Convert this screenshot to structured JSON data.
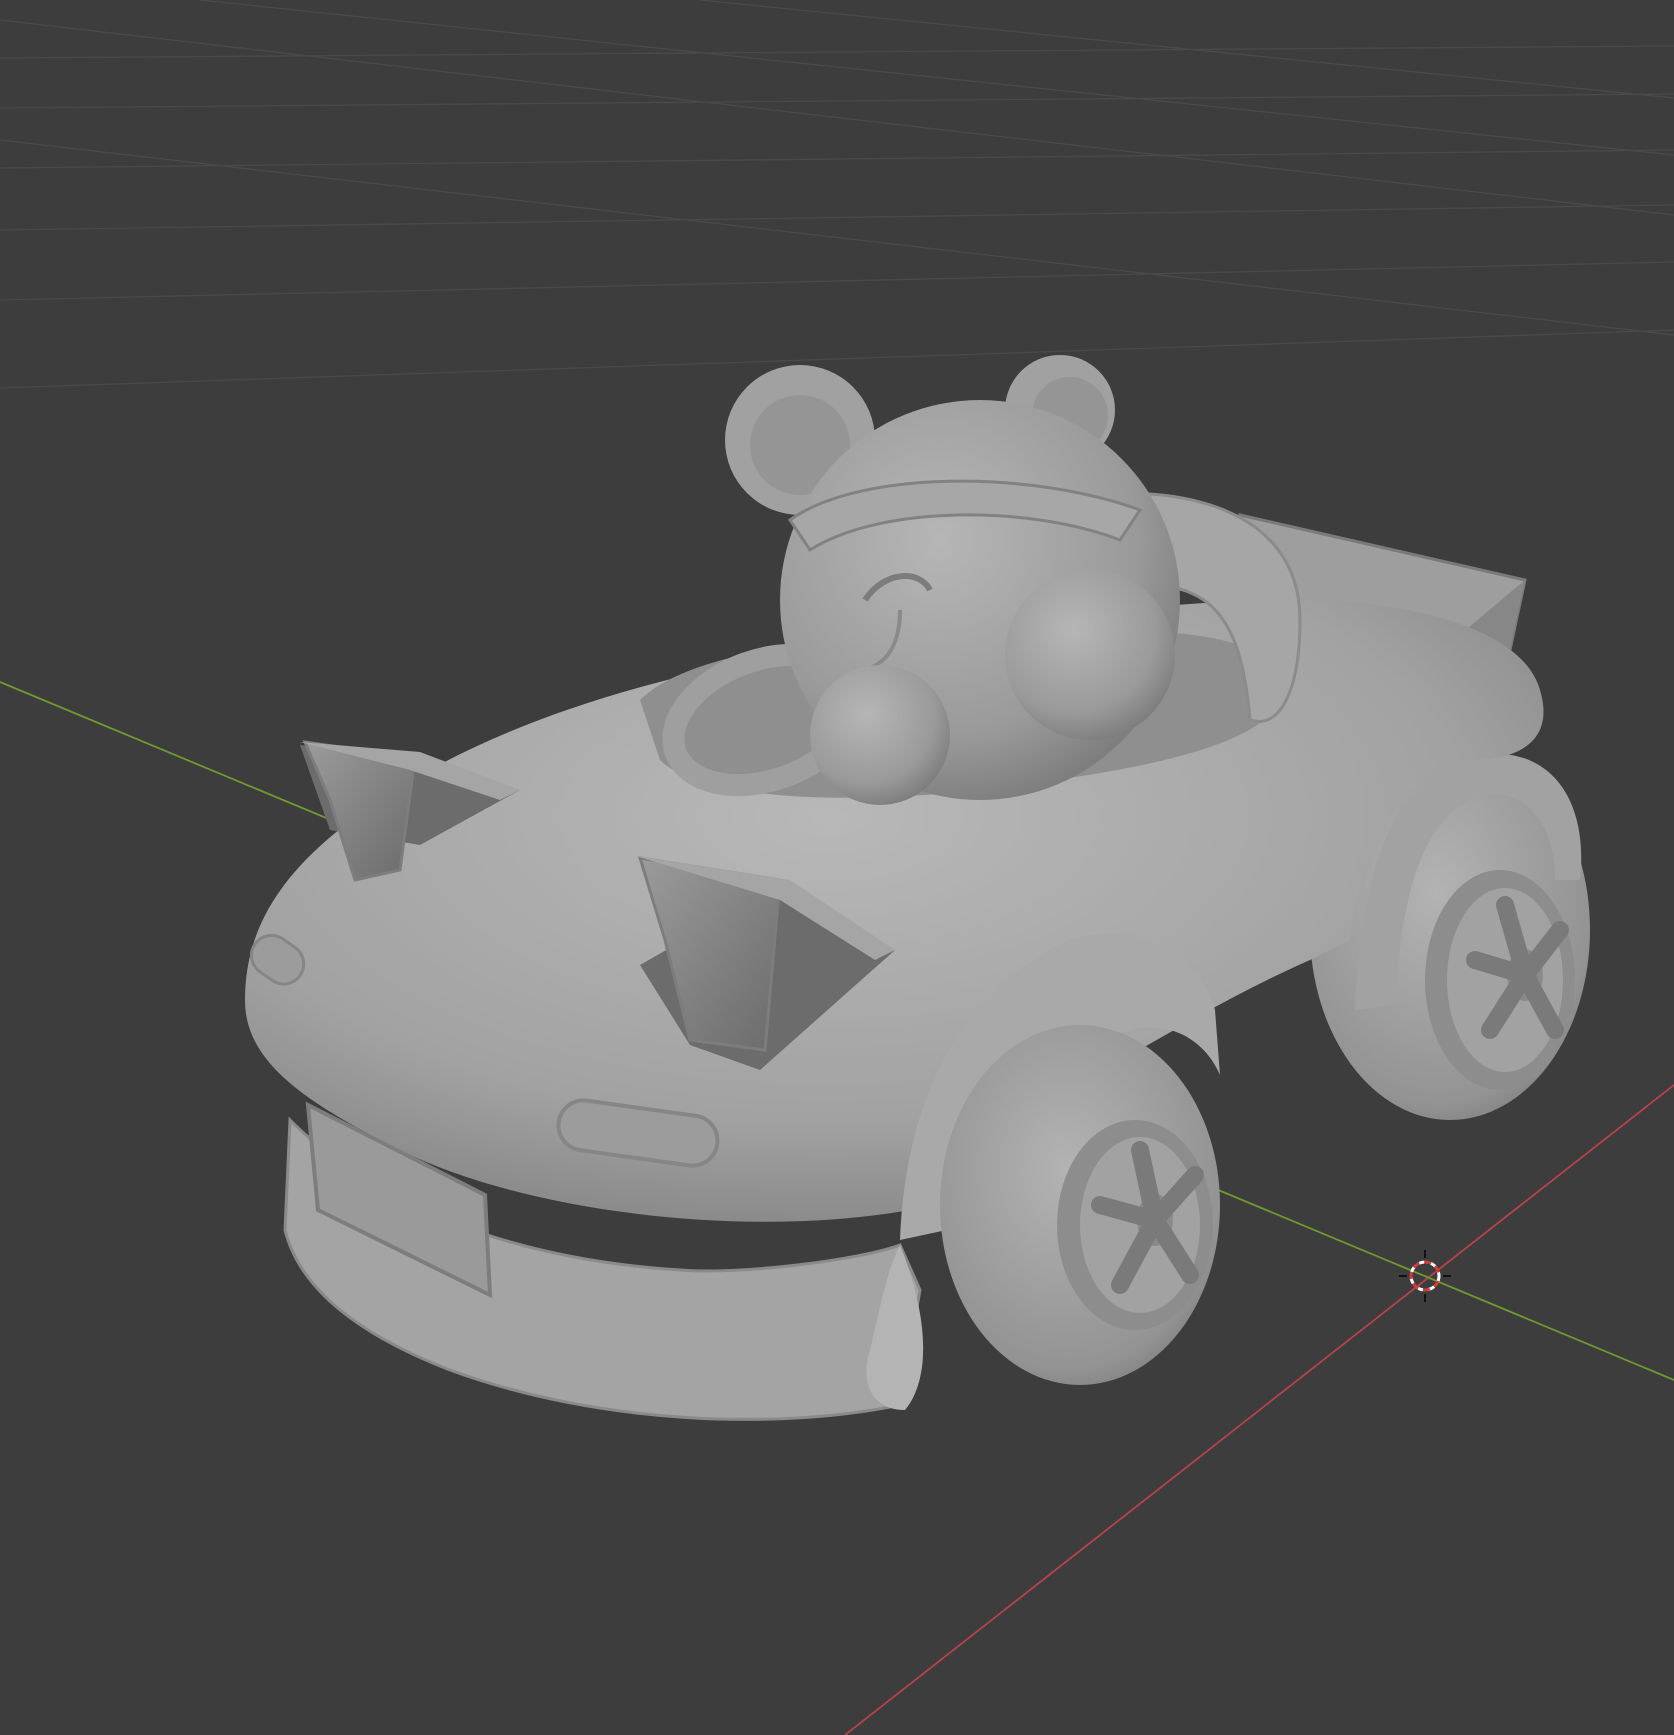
{
  "viewport": {
    "mode": "solid-shading",
    "background_color": "#3d3d3d",
    "grid_color": "#4a4a4a",
    "x_axis_color": "#b5424d",
    "y_axis_color": "#6f9a2f",
    "object_color": "#a7a7a7",
    "object_shadow_color": "#727272",
    "object_highlight_color": "#cfcfcf"
  },
  "scene": {
    "object": "cartoon-mouse-driving-car",
    "cursor_icon": "3d-cursor-icon"
  }
}
